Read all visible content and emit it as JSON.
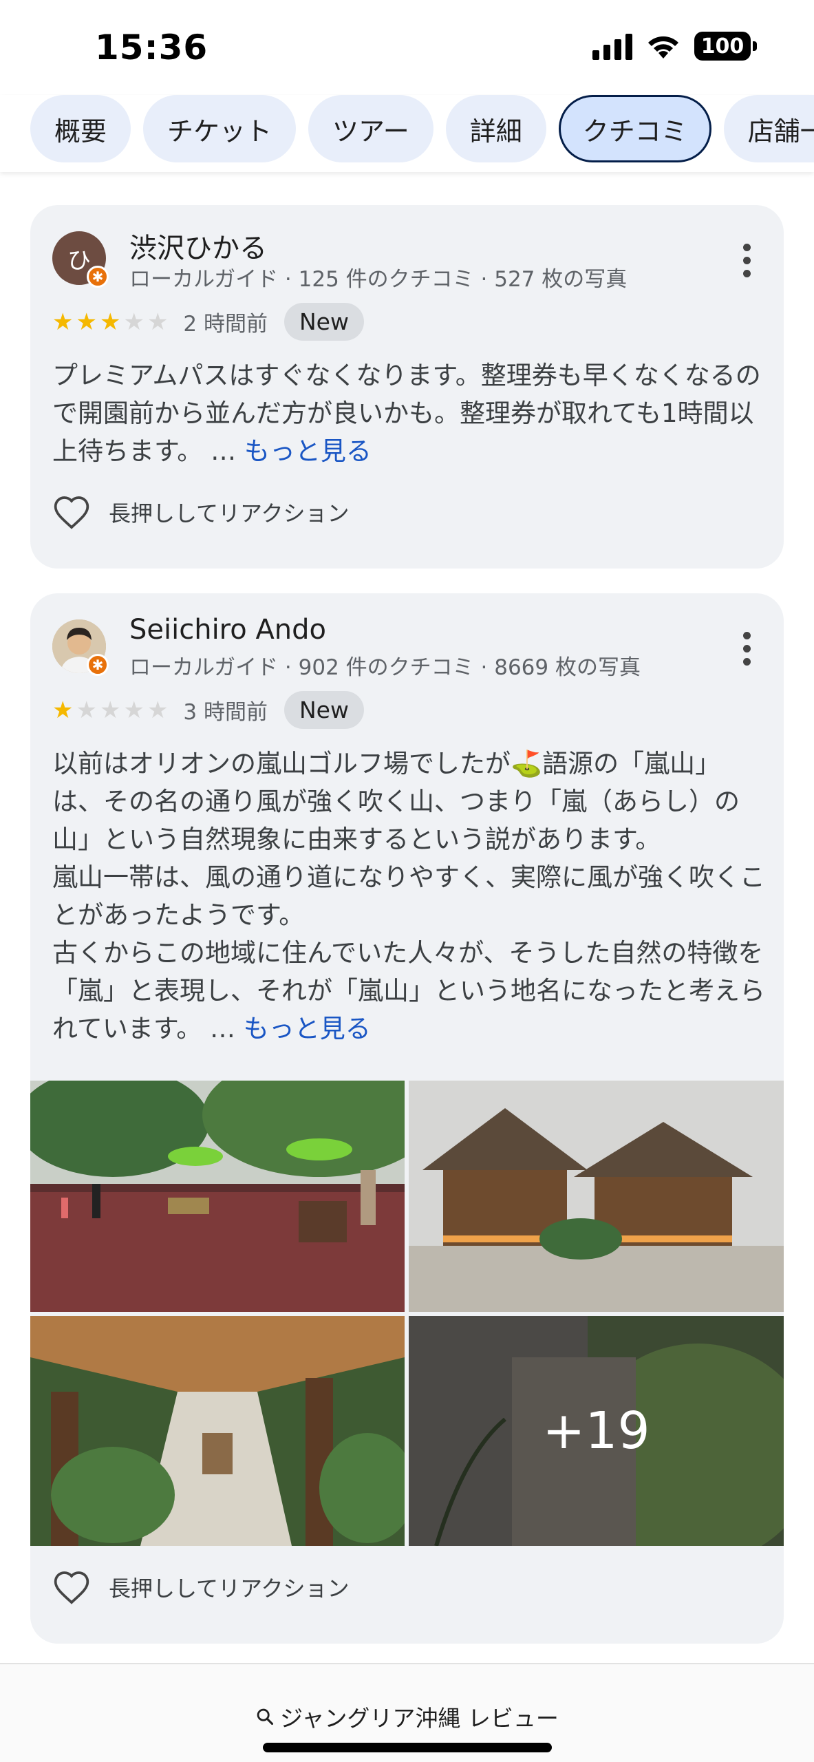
{
  "status": {
    "time": "15:36",
    "battery": "100"
  },
  "tabs": [
    {
      "label": "概要",
      "active": false
    },
    {
      "label": "チケット",
      "active": false
    },
    {
      "label": "ツアー",
      "active": false
    },
    {
      "label": "詳細",
      "active": false
    },
    {
      "label": "クチコミ",
      "active": true
    },
    {
      "label": "店舗一",
      "active": false
    }
  ],
  "reviews": [
    {
      "avatar_initial": "ひ",
      "name": "渋沢ひかる",
      "meta": "ローカルガイド · 125 件のクチコミ · 527 枚の写真",
      "rating": 3,
      "time_ago": "2 時間前",
      "badge": "New",
      "text": "プレミアムパスはすぐなくなります。整理券も早くなくなるので開園前から並んだ方が良いかも。整理券が取れても1時間以上待ちます。",
      "more_ellipsis": "…",
      "more_link": "もっと見る",
      "reaction_label": "長押ししてリアクション"
    },
    {
      "name": "Seiichiro Ando",
      "meta": "ローカルガイド · 902 件のクチコミ · 8669 枚の写真",
      "rating": 1,
      "time_ago": "3 時間前",
      "badge": "New",
      "text_lines": [
        "以前はオリオンの嵐山ゴルフ場でしたが⛳語源の「嵐山」は、その名の通り風が強く吹く山、つまり「嵐（あらし）の山」という自然現象に由来するという説があります。",
        "嵐山一帯は、風の通り道になりやすく、実際に風が強く吹くことがあったようです。",
        "古くからこの地域に住んでいた人々が、そうした自然の特徴を「嵐」と表現し、それが「嵐山」という地名になったと考えられています。"
      ],
      "more_ellipsis": "…",
      "more_link": "もっと見る",
      "photos_more": "+19",
      "reaction_label": "長押ししてリアクション"
    }
  ],
  "bottom": {
    "search_text": "ジャングリア沖縄 レビュー"
  },
  "colors": {
    "star_on": "#f5b800",
    "star_off": "#d6d6d6",
    "link": "#1a56c4",
    "card_bg": "#f0f2f5",
    "tab_bg": "#e8eefa",
    "tab_active_bg": "#d3e3fd",
    "badge_orange": "#e8710a"
  },
  "icons": [
    "signal-icon",
    "wifi-icon",
    "battery-icon",
    "more-vert-icon",
    "heart-outline-icon",
    "search-icon",
    "local-guide-badge-icon",
    "star-icon"
  ]
}
